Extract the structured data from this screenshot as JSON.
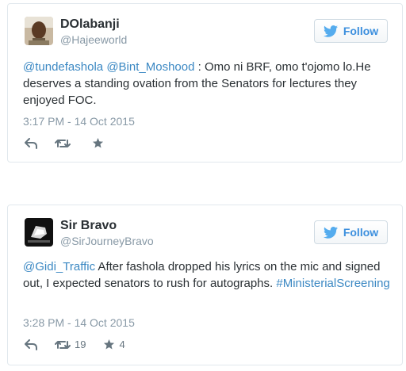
{
  "tweets": [
    {
      "author": {
        "name": "DOlabanji",
        "handle": "@Hajeeworld"
      },
      "follow_label": "Follow",
      "text_parts": [
        {
          "text": "@tundefashola",
          "link": true
        },
        {
          "text": " ",
          "link": false
        },
        {
          "text": "@Bint_Moshood",
          "link": true
        },
        {
          "text": " : Omo ni BRF, omo t'ojomo lo.He deserves a standing ovation from the Senators for lectures they enjoyed FOC.",
          "link": false
        }
      ],
      "timestamp": "3:17 PM - 14 Oct 2015",
      "retweets": "",
      "likes": ""
    },
    {
      "author": {
        "name": "Sir Bravo",
        "handle": "@SirJourneyBravo"
      },
      "follow_label": "Follow",
      "text_parts": [
        {
          "text": "@Gidi_Traffic",
          "link": true
        },
        {
          "text": " After fashola dropped his lyrics on the mic and signed out, I expected senators to rush for autographs. ",
          "link": false
        },
        {
          "text": "#MinisterialScreening",
          "link": true
        }
      ],
      "timestamp": "3:28 PM - 14 Oct 2015",
      "retweets": "19",
      "likes": "4"
    }
  ],
  "icons": {
    "bird": "twitter-bird-icon",
    "reply": "reply-icon",
    "retweet": "retweet-icon",
    "like": "star-icon"
  },
  "colors": {
    "link": "#3b88c3",
    "follow": "#3c8fde",
    "meta": "#8899a6",
    "border": "#e1e8ed",
    "action_icon": "#66757f"
  }
}
